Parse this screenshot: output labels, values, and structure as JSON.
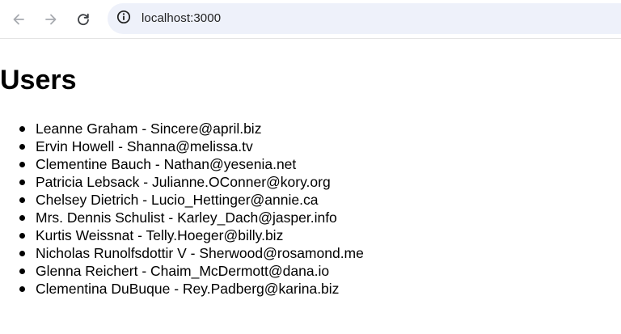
{
  "browser": {
    "url": "localhost:3000"
  },
  "page": {
    "heading": "Users",
    "users": [
      {
        "name": "Leanne Graham",
        "email": "Sincere@april.biz"
      },
      {
        "name": "Ervin Howell",
        "email": "Shanna@melissa.tv"
      },
      {
        "name": "Clementine Bauch",
        "email": "Nathan@yesenia.net"
      },
      {
        "name": "Patricia Lebsack",
        "email": "Julianne.OConner@kory.org"
      },
      {
        "name": "Chelsey Dietrich",
        "email": "Lucio_Hettinger@annie.ca"
      },
      {
        "name": "Mrs. Dennis Schulist",
        "email": "Karley_Dach@jasper.info"
      },
      {
        "name": "Kurtis Weissnat",
        "email": "Telly.Hoeger@billy.biz"
      },
      {
        "name": "Nicholas Runolfsdottir V",
        "email": "Sherwood@rosamond.me"
      },
      {
        "name": "Glenna Reichert",
        "email": "Chaim_McDermott@dana.io"
      },
      {
        "name": "Clementina DuBuque",
        "email": "Rey.Padberg@karina.biz"
      }
    ]
  },
  "icons": {
    "back": "arrow-left-icon",
    "forward": "arrow-right-icon",
    "reload": "reload-icon",
    "site_info": "site-info-icon"
  },
  "colors": {
    "omnibox_bg": "#eef1fa",
    "icon": "#5f6368",
    "icon_disabled": "#a8abb0"
  }
}
